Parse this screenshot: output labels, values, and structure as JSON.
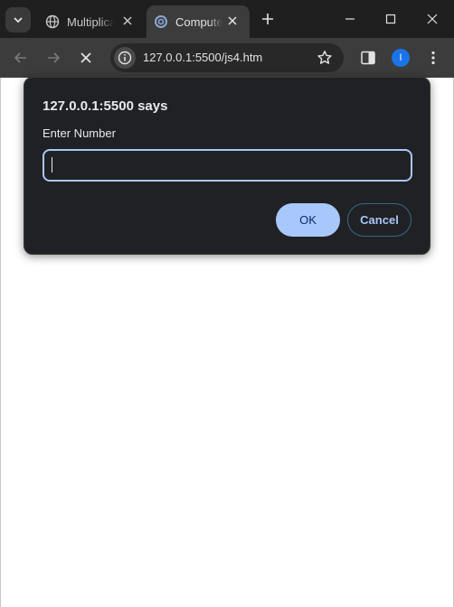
{
  "tabs": [
    {
      "title": "Multiplication",
      "favicon": "globe-icon",
      "active": false
    },
    {
      "title": "Computer",
      "favicon": "loading-spinner-icon",
      "active": true
    }
  ],
  "omnibox": {
    "url": "127.0.0.1:5500/js4.htm"
  },
  "profile": {
    "initial": "I",
    "color": "#1a73e8"
  },
  "dialog": {
    "title": "127.0.0.1:5500 says",
    "message": "Enter Number",
    "input_value": "",
    "ok_label": "OK",
    "cancel_label": "Cancel"
  },
  "colors": {
    "tabstrip": "#1f1f1f",
    "toolbar": "#3c3c3c",
    "dialog_bg": "#202124",
    "accent": "#a8c7fa"
  }
}
